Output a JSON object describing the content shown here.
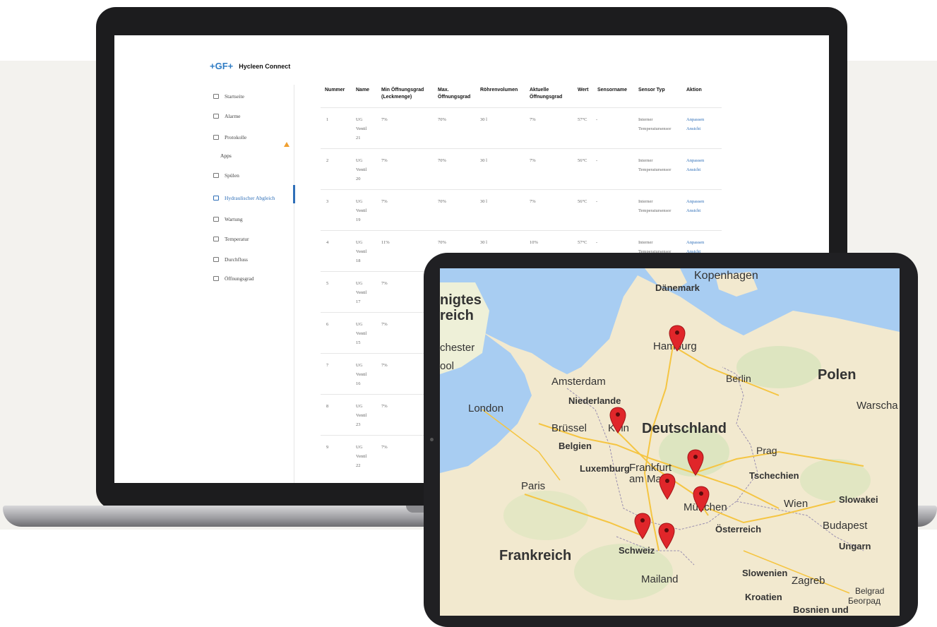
{
  "app": {
    "logo": "+GF+",
    "name": "Hycleen Connect"
  },
  "sidebar": {
    "items": [
      {
        "label": "Startseite"
      },
      {
        "label": "Alarme"
      },
      {
        "label": "Protokolle"
      },
      {
        "label": "Spülen"
      },
      {
        "label": "Hydraulischer Abgleich"
      },
      {
        "label": "Wartung"
      },
      {
        "label": "Temperatur"
      },
      {
        "label": "Durchfluss"
      },
      {
        "label": "Öffnungsgrad"
      }
    ],
    "section_label": "Apps"
  },
  "table": {
    "headers": [
      "Nummer",
      "Name",
      "Min Öffnungsgrad (Leckmenge)",
      "Max. Öffnungsgrad",
      "Röhrenvolumen",
      "Aktuelle Öffnungsgrad",
      "Wert",
      "Sensorname",
      "Sensor Typ",
      "Aktion"
    ],
    "rows": [
      {
        "nummer": "1",
        "name": "UG Ventil 21",
        "min": "7%",
        "max": "70%",
        "vol": "30 l",
        "akt": "7%",
        "wert": "57°C",
        "sensor": "-",
        "typ": "Interner Temperatursensor",
        "aktion1": "Anpassen",
        "aktion2": "Ansicht"
      },
      {
        "nummer": "2",
        "name": "UG Ventil 20",
        "min": "7%",
        "max": "70%",
        "vol": "30 l",
        "akt": "7%",
        "wert": "56°C",
        "sensor": "-",
        "typ": "Interner Temperatursensor",
        "aktion1": "Anpassen",
        "aktion2": "Ansicht"
      },
      {
        "nummer": "3",
        "name": "UG Ventil 19",
        "min": "7%",
        "max": "70%",
        "vol": "30 l",
        "akt": "7%",
        "wert": "56°C",
        "sensor": "-",
        "typ": "Interner Temperatursensor",
        "aktion1": "Anpassen",
        "aktion2": "Ansicht"
      },
      {
        "nummer": "4",
        "name": "UG Ventil 18",
        "min": "11%",
        "max": "70%",
        "vol": "30 l",
        "akt": "10%",
        "wert": "57°C",
        "sensor": "-",
        "typ": "Interner Temperatursensor",
        "aktion1": "Anpassen",
        "aktion2": "Ansicht"
      },
      {
        "nummer": "5",
        "name": "UG Ventil 17",
        "min": "7%"
      },
      {
        "nummer": "6",
        "name": "UG Ventil 15",
        "min": "7%"
      },
      {
        "nummer": "7",
        "name": "UG Ventil 16",
        "min": "7%"
      },
      {
        "nummer": "8",
        "name": "UG Ventil 23",
        "min": "7%"
      },
      {
        "nummer": "9",
        "name": "UG Ventil 22",
        "min": "7%"
      }
    ]
  },
  "map": {
    "labels": [
      "Kopenhagen",
      "Dänemark",
      "nigtes",
      "reich",
      "chester",
      "ool",
      "Hamburg",
      "Amsterdam",
      "Niederlande",
      "Berlin",
      "Polen",
      "Warscha",
      "London",
      "Brüssel",
      "Köln",
      "Belgien",
      "Deutschland",
      "Prag",
      "Luxemburg",
      "Frankfurt",
      "am Main",
      "Tschechien",
      "Paris",
      "München",
      "Wien",
      "Slowakei",
      "Österreich",
      "Budapest",
      "Schweiz",
      "Ungarn",
      "Frankreich",
      "Mailand",
      "Slowenien",
      "Zagreb",
      "Kroatien",
      "Belgrad",
      "Београд",
      "Bosnien und"
    ],
    "marker_count": 7
  }
}
